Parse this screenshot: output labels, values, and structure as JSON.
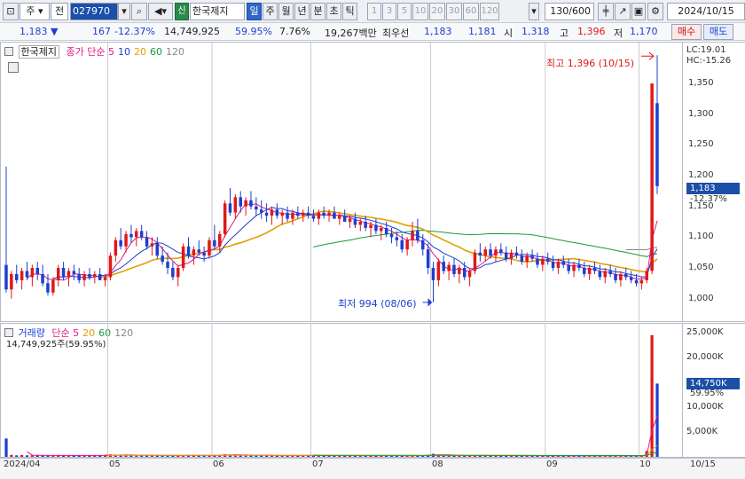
{
  "toolbar": {
    "type_label": "주",
    "prev_label": "전",
    "code": "027970",
    "sin_label": "신",
    "name": "한국제지",
    "period_tabs": [
      "일",
      "주",
      "월",
      "년",
      "분",
      "초",
      "틱"
    ],
    "active_period": "일",
    "intervals": [
      "1",
      "3",
      "5",
      "10",
      "20",
      "30",
      "60",
      "120"
    ],
    "count": "130/600",
    "date": "2024/10/15"
  },
  "quote": {
    "price": "1,183 ▼",
    "change": "167",
    "change_pct": "-12.37%",
    "volume": "14,749,925",
    "volume_ratio": "59.95%",
    "turnover": "7.76%",
    "amount": "19,267백만",
    "ask_label": "최우선",
    "ask": "1,183",
    "bid": "1,181",
    "open_label": "시",
    "open": "1,318",
    "high_label": "고",
    "high": "1,396",
    "low_label": "저",
    "low": "1,170",
    "buy_label": "매수",
    "sell_label": "매도"
  },
  "price_panel": {
    "name": "한국제지",
    "legend": [
      {
        "label": "종가 단순 5",
        "color": "#e0188a"
      },
      {
        "label": "10",
        "color": "#1b3fd0"
      },
      {
        "label": "20",
        "color": "#e0a000"
      },
      {
        "label": "60",
        "color": "#1a9a3a"
      },
      {
        "label": "120",
        "color": "#888888"
      }
    ],
    "lc": "LC:19.01",
    "hc": "HC:-15.26",
    "high_note": "최고 1,396 (10/15)",
    "low_note": "최저 994 (08/06)",
    "price_ticks": [
      "1,350",
      "1,300",
      "1,250",
      "1,200",
      "1,150",
      "1,100",
      "1,050",
      "1,000"
    ],
    "current_badge": "1,183",
    "current_pct": "-12.37%"
  },
  "volume_panel": {
    "title": "거래량",
    "legend": [
      {
        "label": "단순 5",
        "color": "#e0188a"
      },
      {
        "label": "20",
        "color": "#e0a000"
      },
      {
        "label": "60",
        "color": "#1a9a3a"
      },
      {
        "label": "120",
        "color": "#888888"
      }
    ],
    "info": "14,749,925주(59.95%)",
    "volume_ticks": [
      "25,000K",
      "20,000K",
      "15,000K",
      "10,000K",
      "5,000K"
    ],
    "current_badge": "14,750K",
    "current_pct": "59.95%"
  },
  "x_axis": [
    "2024/04",
    "05",
    "06",
    "07",
    "08",
    "09",
    "10",
    "10/15"
  ],
  "chart_data": {
    "type": "candlestick",
    "y_range": [
      975,
      1405
    ],
    "volume_range": [
      0,
      25000
    ],
    "months": [
      {
        "label": "2024/04",
        "first_index": 0
      },
      {
        "label": "05",
        "first_index": 20
      },
      {
        "label": "06",
        "first_index": 40
      },
      {
        "label": "07",
        "first_index": 59
      },
      {
        "label": "08",
        "first_index": 82
      },
      {
        "label": "09",
        "first_index": 104
      },
      {
        "label": "10",
        "first_index": 122
      }
    ],
    "ohlc_key": [
      "open",
      "high",
      "low",
      "close"
    ],
    "ohlc": [
      [
        1055,
        1215,
        1010,
        1015
      ],
      [
        1015,
        1045,
        1000,
        1040
      ],
      [
        1040,
        1055,
        1025,
        1030
      ],
      [
        1030,
        1050,
        1015,
        1045
      ],
      [
        1045,
        1060,
        1030,
        1035
      ],
      [
        1035,
        1055,
        1020,
        1050
      ],
      [
        1050,
        1060,
        1030,
        1040
      ],
      [
        1040,
        1055,
        1020,
        1025
      ],
      [
        1025,
        1040,
        1005,
        1010
      ],
      [
        1010,
        1035,
        1005,
        1030
      ],
      [
        1030,
        1055,
        1020,
        1050
      ],
      [
        1050,
        1060,
        1030,
        1035
      ],
      [
        1035,
        1050,
        1020,
        1045
      ],
      [
        1045,
        1055,
        1030,
        1040
      ],
      [
        1040,
        1050,
        1025,
        1030
      ],
      [
        1030,
        1045,
        1020,
        1040
      ],
      [
        1040,
        1050,
        1030,
        1035
      ],
      [
        1035,
        1045,
        1025,
        1040
      ],
      [
        1040,
        1050,
        1030,
        1030
      ],
      [
        1030,
        1040,
        1020,
        1035
      ],
      [
        1035,
        1075,
        1030,
        1070
      ],
      [
        1070,
        1100,
        1060,
        1095
      ],
      [
        1095,
        1115,
        1080,
        1085
      ],
      [
        1085,
        1110,
        1075,
        1105
      ],
      [
        1105,
        1120,
        1090,
        1100
      ],
      [
        1100,
        1115,
        1085,
        1110
      ],
      [
        1110,
        1120,
        1095,
        1100
      ],
      [
        1100,
        1110,
        1080,
        1085
      ],
      [
        1085,
        1100,
        1070,
        1090
      ],
      [
        1090,
        1100,
        1065,
        1070
      ],
      [
        1070,
        1085,
        1055,
        1060
      ],
      [
        1060,
        1075,
        1040,
        1050
      ],
      [
        1050,
        1060,
        1030,
        1035
      ],
      [
        1035,
        1055,
        1020,
        1050
      ],
      [
        1050,
        1090,
        1045,
        1085
      ],
      [
        1085,
        1100,
        1065,
        1070
      ],
      [
        1070,
        1085,
        1055,
        1080
      ],
      [
        1080,
        1095,
        1070,
        1075
      ],
      [
        1075,
        1085,
        1060,
        1070
      ],
      [
        1070,
        1100,
        1065,
        1095
      ],
      [
        1095,
        1120,
        1080,
        1085
      ],
      [
        1085,
        1110,
        1075,
        1105
      ],
      [
        1105,
        1160,
        1100,
        1155
      ],
      [
        1155,
        1180,
        1135,
        1140
      ],
      [
        1140,
        1170,
        1130,
        1165
      ],
      [
        1165,
        1175,
        1140,
        1150
      ],
      [
        1150,
        1165,
        1135,
        1160
      ],
      [
        1160,
        1175,
        1145,
        1150
      ],
      [
        1150,
        1165,
        1135,
        1145
      ],
      [
        1145,
        1160,
        1130,
        1140
      ],
      [
        1140,
        1155,
        1125,
        1135
      ],
      [
        1135,
        1150,
        1120,
        1145
      ],
      [
        1145,
        1155,
        1130,
        1135
      ],
      [
        1135,
        1145,
        1120,
        1140
      ],
      [
        1140,
        1150,
        1125,
        1130
      ],
      [
        1130,
        1145,
        1120,
        1140
      ],
      [
        1140,
        1150,
        1130,
        1135
      ],
      [
        1135,
        1145,
        1125,
        1140
      ],
      [
        1140,
        1150,
        1130,
        1135
      ],
      [
        1135,
        1145,
        1125,
        1130
      ],
      [
        1130,
        1145,
        1120,
        1140
      ],
      [
        1140,
        1150,
        1130,
        1135
      ],
      [
        1135,
        1145,
        1125,
        1140
      ],
      [
        1140,
        1150,
        1130,
        1130
      ],
      [
        1130,
        1140,
        1120,
        1135
      ],
      [
        1135,
        1145,
        1125,
        1125
      ],
      [
        1125,
        1135,
        1115,
        1130
      ],
      [
        1130,
        1140,
        1115,
        1120
      ],
      [
        1120,
        1130,
        1110,
        1125
      ],
      [
        1125,
        1135,
        1110,
        1115
      ],
      [
        1115,
        1125,
        1100,
        1120
      ],
      [
        1120,
        1130,
        1105,
        1110
      ],
      [
        1110,
        1120,
        1095,
        1115
      ],
      [
        1115,
        1125,
        1100,
        1105
      ],
      [
        1105,
        1115,
        1090,
        1100
      ],
      [
        1100,
        1110,
        1085,
        1095
      ],
      [
        1095,
        1105,
        1075,
        1080
      ],
      [
        1080,
        1100,
        1070,
        1095
      ],
      [
        1095,
        1125,
        1085,
        1110
      ],
      [
        1110,
        1130,
        1090,
        1095
      ],
      [
        1095,
        1105,
        1070,
        1080
      ],
      [
        1080,
        1090,
        1040,
        1050
      ],
      [
        1050,
        1060,
        994,
        1030
      ],
      [
        1030,
        1065,
        1020,
        1060
      ],
      [
        1060,
        1070,
        1040,
        1045
      ],
      [
        1045,
        1060,
        1030,
        1055
      ],
      [
        1055,
        1065,
        1035,
        1040
      ],
      [
        1040,
        1055,
        1025,
        1050
      ],
      [
        1050,
        1060,
        1030,
        1035
      ],
      [
        1035,
        1050,
        1020,
        1045
      ],
      [
        1045,
        1080,
        1040,
        1075
      ],
      [
        1075,
        1090,
        1060,
        1070
      ],
      [
        1070,
        1085,
        1060,
        1080
      ],
      [
        1080,
        1090,
        1065,
        1070
      ],
      [
        1070,
        1085,
        1060,
        1080
      ],
      [
        1080,
        1090,
        1070,
        1075
      ],
      [
        1075,
        1085,
        1060,
        1065
      ],
      [
        1065,
        1080,
        1055,
        1075
      ],
      [
        1075,
        1085,
        1065,
        1070
      ],
      [
        1070,
        1080,
        1055,
        1060
      ],
      [
        1060,
        1075,
        1050,
        1070
      ],
      [
        1070,
        1080,
        1060,
        1065
      ],
      [
        1065,
        1075,
        1050,
        1055
      ],
      [
        1055,
        1070,
        1045,
        1065
      ],
      [
        1065,
        1075,
        1055,
        1060
      ],
      [
        1060,
        1070,
        1045,
        1050
      ],
      [
        1050,
        1065,
        1040,
        1060
      ],
      [
        1060,
        1070,
        1050,
        1055
      ],
      [
        1055,
        1065,
        1040,
        1045
      ],
      [
        1045,
        1060,
        1035,
        1055
      ],
      [
        1055,
        1065,
        1045,
        1050
      ],
      [
        1050,
        1060,
        1035,
        1040
      ],
      [
        1040,
        1055,
        1030,
        1050
      ],
      [
        1050,
        1060,
        1040,
        1045
      ],
      [
        1045,
        1055,
        1030,
        1035
      ],
      [
        1035,
        1050,
        1025,
        1045
      ],
      [
        1045,
        1055,
        1035,
        1040
      ],
      [
        1040,
        1050,
        1025,
        1030
      ],
      [
        1030,
        1045,
        1020,
        1040
      ],
      [
        1040,
        1050,
        1030,
        1035
      ],
      [
        1035,
        1045,
        1025,
        1030
      ],
      [
        1030,
        1040,
        1020,
        1025
      ],
      [
        1025,
        1035,
        1015,
        1030
      ],
      [
        1030,
        1050,
        1025,
        1045
      ],
      [
        1045,
        1350,
        1040,
        1350
      ],
      [
        1318,
        1396,
        1170,
        1183
      ]
    ],
    "volume": [
      3700,
      400,
      300,
      350,
      300,
      320,
      300,
      280,
      260,
      300,
      300,
      280,
      300,
      290,
      270,
      300,
      280,
      290,
      270,
      280,
      500,
      400,
      350,
      330,
      320,
      310,
      300,
      290,
      280,
      300,
      280,
      270,
      260,
      300,
      350,
      300,
      280,
      290,
      270,
      300,
      350,
      330,
      500,
      400,
      350,
      330,
      320,
      310,
      300,
      290,
      280,
      300,
      290,
      280,
      270,
      290,
      280,
      270,
      280,
      270,
      280,
      270,
      260,
      270,
      260,
      270,
      260,
      250,
      260,
      250,
      260,
      250,
      240,
      250,
      240,
      250,
      240,
      260,
      280,
      300,
      280,
      400,
      600,
      350,
      300,
      280,
      290,
      270,
      260,
      260,
      280,
      270,
      260,
      270,
      260,
      250,
      260,
      250,
      240,
      250,
      240,
      250,
      240,
      230,
      240,
      230,
      240,
      230,
      220,
      230,
      220,
      230,
      220,
      230,
      220,
      210,
      220,
      210,
      220,
      220,
      230,
      220,
      240,
      1200,
      24500,
      14750
    ]
  }
}
